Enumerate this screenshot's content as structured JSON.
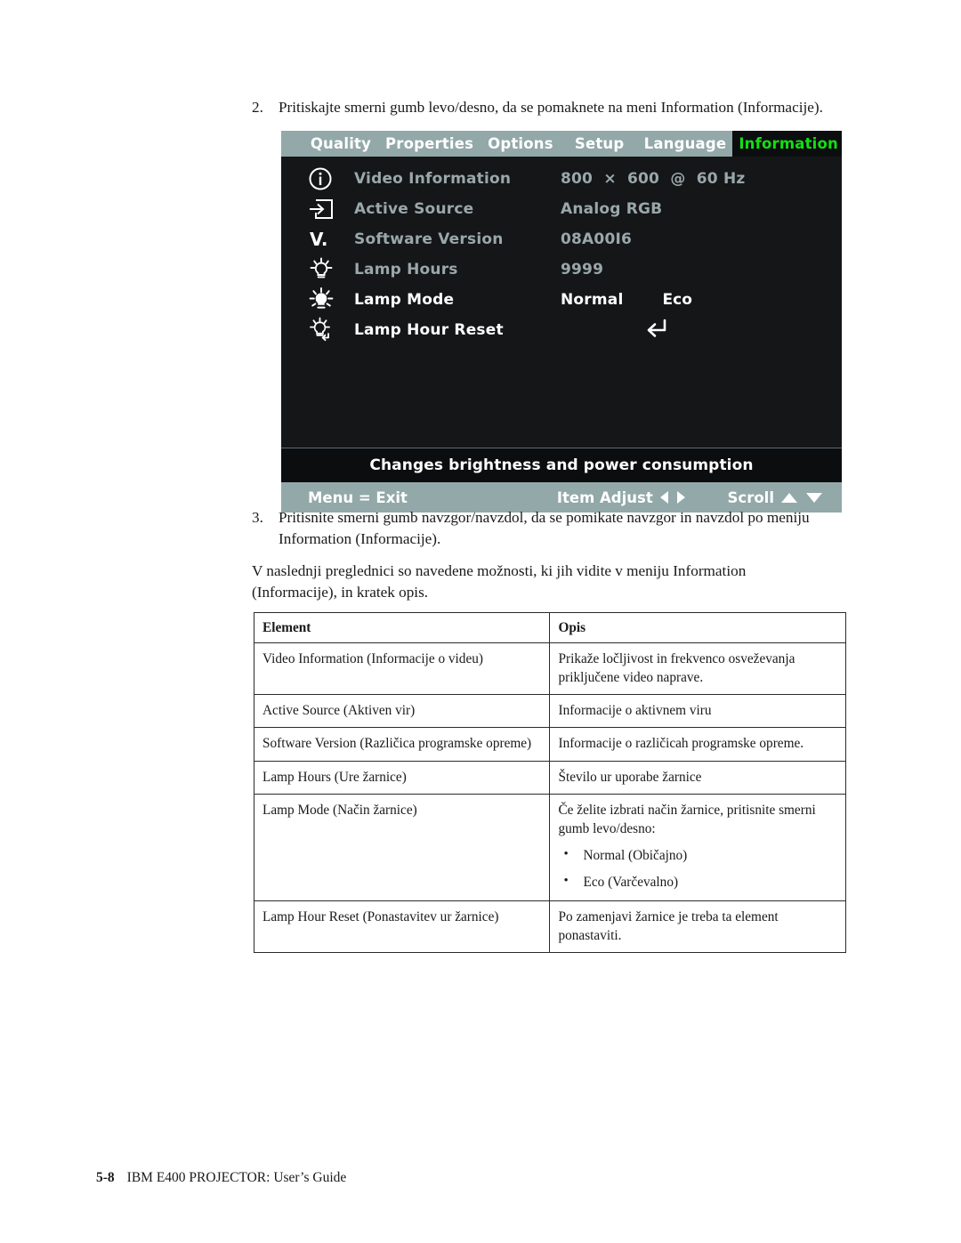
{
  "steps": {
    "step2": {
      "number": "2.",
      "text": "Pritiskajte smerni gumb levo/desno, da se pomaknete na meni Information (Informacije)."
    },
    "step3": {
      "number": "3.",
      "text": "Pritisnite smerni gumb navzgor/navzdol, da se pomikate navzgor in navzdol po meniju Information (Informacije)."
    }
  },
  "intro_paragraph": "V naslednji preglednici so navedene možnosti, ki jih vidite v meniju Information (Informacije), in kratek opis.",
  "osd": {
    "tabs": [
      {
        "label": "Quality",
        "active": false
      },
      {
        "label": "Properties",
        "active": false
      },
      {
        "label": "Options",
        "active": false
      },
      {
        "label": "Setup",
        "active": false
      },
      {
        "label": "Language",
        "active": false
      },
      {
        "label": "Information",
        "active": true
      }
    ],
    "rows": [
      {
        "icon": "info-circle-icon",
        "label": "Video Information",
        "value": "800  ×  600  @  60 Hz",
        "value2": "",
        "selected": false
      },
      {
        "icon": "input-source-icon",
        "label": "Active Source",
        "value": "Analog RGB",
        "value2": "",
        "selected": false
      },
      {
        "icon": "version-icon",
        "label": "Software Version",
        "value": "08A00I6",
        "value2": "",
        "selected": false
      },
      {
        "icon": "lamp-hours-icon",
        "label": "Lamp Hours",
        "value": "9999",
        "value2": "",
        "selected": false
      },
      {
        "icon": "lamp-mode-icon",
        "label": "Lamp Mode",
        "value": "Normal",
        "value2": "Eco",
        "selected": true
      },
      {
        "icon": "lamp-reset-icon",
        "label": "Lamp Hour Reset",
        "value": "↵",
        "value2": "",
        "selected": true
      }
    ],
    "hint": "Changes brightness and power consumption",
    "status": {
      "exit": "Menu = Exit",
      "adjust": "Item Adjust",
      "scroll": "Scroll"
    },
    "colors": {
      "tab_bar": "#93a8a8",
      "active_tab_text": "#11e011",
      "background": "#141617"
    }
  },
  "table": {
    "headers": [
      "Element",
      "Opis"
    ],
    "rows": [
      {
        "element": "Video Information (Informacije o videu)",
        "description": "Prikaže ločljivost in frekvenco osveževanja priključene video naprave."
      },
      {
        "element": "Active Source (Aktiven vir)",
        "description": "Informacije o aktivnem viru"
      },
      {
        "element": "Software Version (Različica programske opreme)",
        "description": "Informacije o različicah programske opreme."
      },
      {
        "element": "Lamp Hours (Ure žarnice)",
        "description": "Število ur uporabe žarnice"
      },
      {
        "element": "Lamp Mode (Način žarnice)",
        "description": "Če želite izbrati način žarnice, pritisnite smerni gumb levo/desno:",
        "bullets": [
          "Normal (Običajno)",
          "Eco (Varčevalno)"
        ]
      },
      {
        "element": "Lamp Hour Reset (Ponastavitev ur žarnice)",
        "description": "Po zamenjavi žarnice je treba ta element ponastaviti."
      }
    ]
  },
  "footer": {
    "page_number": "5-8",
    "text": "IBM E400 PROJECTOR: User’s Guide"
  }
}
